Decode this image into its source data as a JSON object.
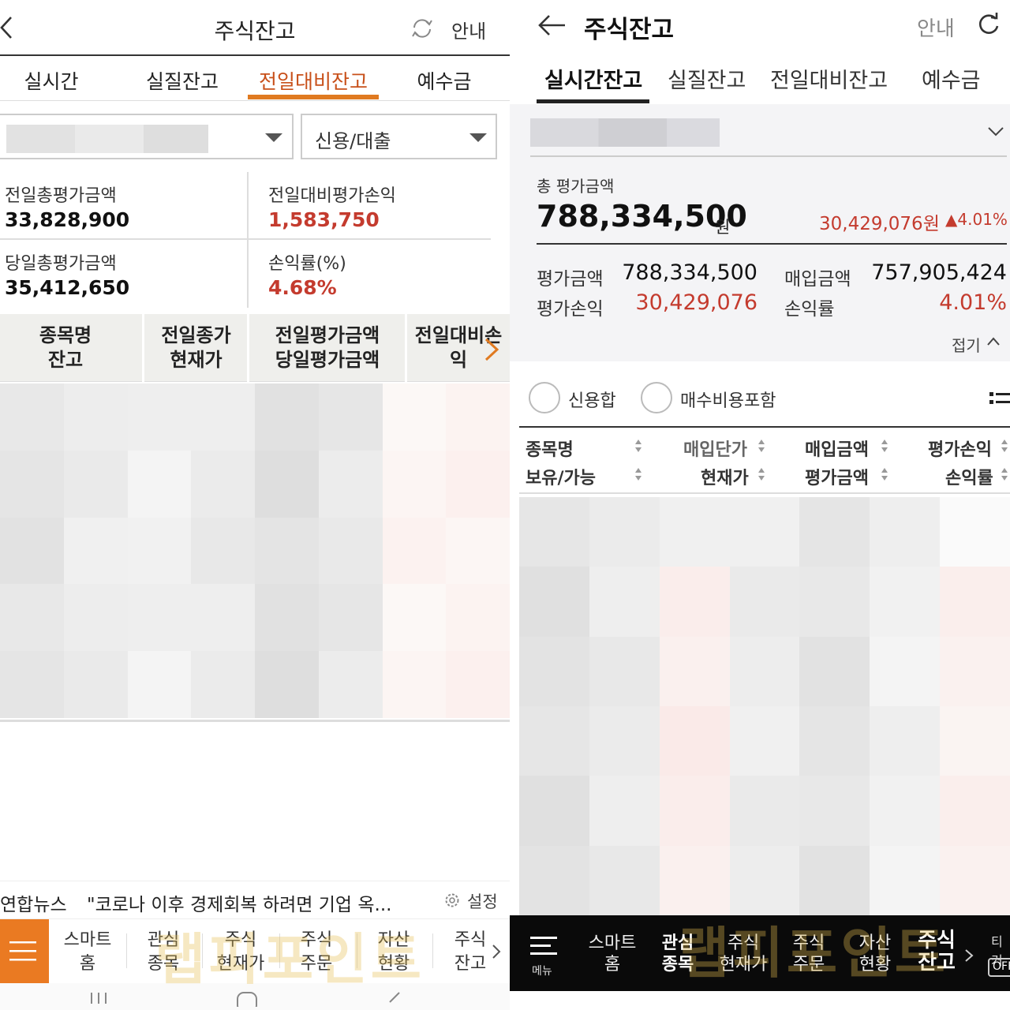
{
  "left": {
    "header": {
      "title": "주식잔고",
      "guide_label": "안내"
    },
    "tabs": [
      {
        "label": "실시간"
      },
      {
        "label": "실질잔고"
      },
      {
        "label": "전일대비잔고",
        "active": true
      },
      {
        "label": "예수금"
      }
    ],
    "credit_select": {
      "value": "신용/대출"
    },
    "summary": {
      "prev_total_eval_label": "전일총평가금액",
      "prev_total_eval_value": "33,828,900",
      "prev_diff_pl_label": "전일대비평가손익",
      "prev_diff_pl_value": "1,583,750",
      "today_total_eval_label": "당일총평가금액",
      "today_total_eval_value": "35,412,650",
      "pl_rate_label": "손익률(%)",
      "pl_rate_value": "4.68%"
    },
    "table_headers": [
      {
        "line1": "종목명",
        "line2": "잔고"
      },
      {
        "line1": "전일종가",
        "line2": "현재가"
      },
      {
        "line1": "전일평가금액",
        "line2": "당일평가금액"
      },
      {
        "line1": "전일대비손",
        "line2": "익"
      }
    ],
    "news": {
      "source": "연합뉴스",
      "headline": "\"코로나 이후 경제회복 하려면 기업 옥...",
      "settings_label": "설정"
    },
    "bottom_nav": [
      {
        "line1": "스마트",
        "line2": "홈"
      },
      {
        "line1": "관심",
        "line2": "종목"
      },
      {
        "line1": "주식",
        "line2": "현재가"
      },
      {
        "line1": "주식",
        "line2": "주문"
      },
      {
        "line1": "자산",
        "line2": "현황"
      },
      {
        "line1": "주식",
        "line2": "잔고"
      }
    ]
  },
  "right": {
    "header": {
      "title": "주식잔고",
      "guide_label": "안내"
    },
    "tabs": [
      {
        "label": "실시간잔고",
        "active": true
      },
      {
        "label": "실질잔고"
      },
      {
        "label": "전일대비잔고"
      },
      {
        "label": "예수금"
      }
    ],
    "summary": {
      "total_eval_label": "총 평가금액",
      "total_eval_value": "788,334,500",
      "total_eval_unit": "원",
      "total_pl": "30,429,076원",
      "total_pct": "▲4.01%",
      "eval_amount_label": "평가금액",
      "eval_amount_value": "788,334,500",
      "buy_amount_label": "매입금액",
      "buy_amount_value": "757,905,424",
      "eval_pl_label": "평가손익",
      "eval_pl_value": "30,429,076",
      "pl_rate_label": "손익률",
      "pl_rate_value": "4.01%",
      "fold_label": "접기"
    },
    "options": {
      "credit_sum_label": "신용합",
      "include_fee_label": "매수비용포함"
    },
    "table_headers": {
      "name": "종목명",
      "hold": "보유/가능",
      "buy_price": "매입단가",
      "current_price": "현재가",
      "buy_amount": "매입금액",
      "eval_amount": "평가금액",
      "eval_pl": "평가손익",
      "pl_rate": "손익률"
    },
    "bottom_nav": {
      "menu_label": "메뉴",
      "items": [
        {
          "line1": "스마트",
          "line2": "홈"
        },
        {
          "line1": "관심",
          "line2": "종목"
        },
        {
          "line1": "주식",
          "line2": "현재가"
        },
        {
          "line1": "주식",
          "line2": "주문"
        },
        {
          "line1": "자산",
          "line2": "현황"
        },
        {
          "line1": "주식",
          "line2": "잔고",
          "active": true
        }
      ],
      "extra_label": "티커",
      "off_label": "OFF"
    }
  },
  "watermark": "랩피포인트",
  "colors": {
    "accent_orange": "#e07a20",
    "loss_red": "#c43b2e",
    "nav_dark": "#0a0a0a"
  }
}
